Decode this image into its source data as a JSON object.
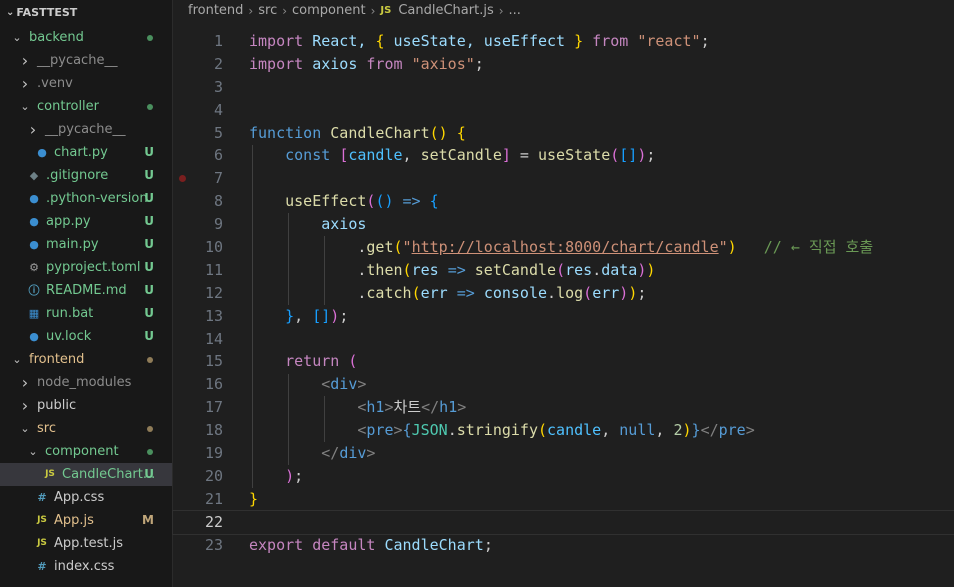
{
  "explorer": {
    "title": "FASTTEST",
    "colors": {
      "folder": "#cccccc",
      "modified": "#e2c08d",
      "untracked": "#73c991",
      "dot_green": "#73c991",
      "dot_tan": "#b59b6e"
    },
    "items": [
      {
        "label": "backend",
        "depth": 0,
        "chev": "down",
        "icon": "",
        "status": "dot",
        "dot_color": "#4a8f5e",
        "color": "#73c991"
      },
      {
        "label": "__pycache__",
        "depth": 1,
        "chev": "right",
        "icon": "",
        "status": "",
        "color": "#8c8c8c"
      },
      {
        "label": ".venv",
        "depth": 1,
        "chev": "right",
        "icon": "",
        "status": "",
        "color": "#8c8c8c"
      },
      {
        "label": "controller",
        "depth": 1,
        "chev": "down",
        "icon": "",
        "status": "dot",
        "dot_color": "#4a8f5e",
        "color": "#73c991"
      },
      {
        "label": "__pycache__",
        "depth": 2,
        "chev": "right",
        "icon": "",
        "status": "",
        "color": "#8c8c8c"
      },
      {
        "label": "chart.py",
        "depth": 2,
        "chev": "",
        "icon": "python",
        "status": "U",
        "color": "#73c991"
      },
      {
        "label": ".gitignore",
        "depth": 1,
        "chev": "",
        "icon": "git",
        "status": "U",
        "color": "#73c991"
      },
      {
        "label": ".python-version",
        "depth": 1,
        "chev": "",
        "icon": "python",
        "status": "U",
        "color": "#73c991"
      },
      {
        "label": "app.py",
        "depth": 1,
        "chev": "",
        "icon": "python",
        "status": "U",
        "color": "#73c991"
      },
      {
        "label": "main.py",
        "depth": 1,
        "chev": "",
        "icon": "python",
        "status": "U",
        "color": "#73c991"
      },
      {
        "label": "pyproject.toml",
        "depth": 1,
        "chev": "",
        "icon": "gear",
        "status": "U",
        "color": "#73c991"
      },
      {
        "label": "README.md",
        "depth": 1,
        "chev": "",
        "icon": "info",
        "status": "U",
        "color": "#73c991"
      },
      {
        "label": "run.bat",
        "depth": 1,
        "chev": "",
        "icon": "windows",
        "status": "U",
        "color": "#73c991"
      },
      {
        "label": "uv.lock",
        "depth": 1,
        "chev": "",
        "icon": "python",
        "status": "U",
        "color": "#73c991"
      },
      {
        "label": "frontend",
        "depth": 0,
        "chev": "down",
        "icon": "",
        "status": "dot",
        "dot_color": "#8f7c58",
        "color": "#e2c08d"
      },
      {
        "label": "node_modules",
        "depth": 1,
        "chev": "right",
        "icon": "",
        "status": "",
        "color": "#8c8c8c"
      },
      {
        "label": "public",
        "depth": 1,
        "chev": "right",
        "icon": "",
        "status": "",
        "color": "#cccccc"
      },
      {
        "label": "src",
        "depth": 1,
        "chev": "down",
        "icon": "",
        "status": "dot",
        "dot_color": "#8f7c58",
        "color": "#e2c08d"
      },
      {
        "label": "component",
        "depth": 2,
        "chev": "down",
        "icon": "",
        "status": "dot",
        "dot_color": "#4a8f5e",
        "color": "#73c991"
      },
      {
        "label": "CandleChart...",
        "depth": 3,
        "chev": "",
        "icon": "js",
        "status": "U",
        "color": "#73c991",
        "selected": true
      },
      {
        "label": "App.css",
        "depth": 2,
        "chev": "",
        "icon": "css",
        "status": "",
        "color": "#cccccc"
      },
      {
        "label": "App.js",
        "depth": 2,
        "chev": "",
        "icon": "js",
        "status": "M",
        "color": "#e2c08d"
      },
      {
        "label": "App.test.js",
        "depth": 2,
        "chev": "",
        "icon": "js",
        "status": "",
        "color": "#cccccc"
      },
      {
        "label": "index.css",
        "depth": 2,
        "chev": "",
        "icon": "css",
        "status": "",
        "color": "#cccccc"
      }
    ]
  },
  "breadcrumb": [
    "frontend",
    "src",
    "component",
    "CandleChart.js",
    "..."
  ],
  "editor": {
    "current_line": 22,
    "breakpoint_line": 7,
    "lines": [
      {
        "n": "1",
        "tokens": [
          [
            "import",
            "#c586c0"
          ],
          [
            " React, ",
            "#9cdcfe"
          ],
          [
            "{",
            "#ffd700"
          ],
          [
            " useState, useEffect ",
            "#9cdcfe"
          ],
          [
            "}",
            "#ffd700"
          ],
          [
            " from ",
            "#c586c0"
          ],
          [
            "\"react\"",
            "#ce9178"
          ],
          [
            ";",
            "#cccccc"
          ]
        ]
      },
      {
        "n": "2",
        "tokens": [
          [
            "import",
            "#c586c0"
          ],
          [
            " axios ",
            "#9cdcfe"
          ],
          [
            "from ",
            "#c586c0"
          ],
          [
            "\"axios\"",
            "#ce9178"
          ],
          [
            ";",
            "#cccccc"
          ]
        ]
      },
      {
        "n": "3",
        "tokens": []
      },
      {
        "n": "4",
        "tokens": []
      },
      {
        "n": "5",
        "tokens": [
          [
            "function ",
            "#569cd6"
          ],
          [
            "CandleChart",
            "#dcdcaa"
          ],
          [
            "() ",
            "#ffd700"
          ],
          [
            "{",
            "#ffd700"
          ]
        ]
      },
      {
        "n": "6",
        "tokens": [
          [
            "    const ",
            "#569cd6"
          ],
          [
            "[",
            "#da70d6"
          ],
          [
            "candle",
            "#4fc1ff"
          ],
          [
            ", ",
            "#cccccc"
          ],
          [
            "setCandle",
            "#dcdcaa"
          ],
          [
            "]",
            "#da70d6"
          ],
          [
            " = ",
            "#cccccc"
          ],
          [
            "useState",
            "#dcdcaa"
          ],
          [
            "(",
            "#da70d6"
          ],
          [
            "[]",
            "#179fff"
          ],
          [
            ")",
            "#da70d6"
          ],
          [
            ";",
            "#cccccc"
          ]
        ]
      },
      {
        "n": "7",
        "tokens": []
      },
      {
        "n": "8",
        "tokens": [
          [
            "    useEffect",
            "#dcdcaa"
          ],
          [
            "(",
            "#da70d6"
          ],
          [
            "() ",
            "#179fff"
          ],
          [
            "=> ",
            "#569cd6"
          ],
          [
            "{",
            "#179fff"
          ]
        ]
      },
      {
        "n": "9",
        "tokens": [
          [
            "        axios",
            "#9cdcfe"
          ]
        ]
      },
      {
        "n": "10",
        "tokens": [
          [
            "            .",
            "#cccccc"
          ],
          [
            "get",
            "#dcdcaa"
          ],
          [
            "(",
            "#ffd700"
          ],
          [
            "\"",
            "#ce9178"
          ],
          [
            "http://localhost:8000/chart/candle",
            "#ce9178",
            "url"
          ],
          [
            "\"",
            "#ce9178"
          ],
          [
            ")",
            "#ffd700"
          ],
          [
            "   ",
            "#cccccc"
          ],
          [
            "// ← 직접 호출",
            "#6a9955"
          ]
        ]
      },
      {
        "n": "11",
        "tokens": [
          [
            "            .",
            "#cccccc"
          ],
          [
            "then",
            "#dcdcaa"
          ],
          [
            "(",
            "#ffd700"
          ],
          [
            "res ",
            "#9cdcfe"
          ],
          [
            "=> ",
            "#569cd6"
          ],
          [
            "setCandle",
            "#dcdcaa"
          ],
          [
            "(",
            "#da70d6"
          ],
          [
            "res",
            "#9cdcfe"
          ],
          [
            ".",
            "#cccccc"
          ],
          [
            "data",
            "#9cdcfe"
          ],
          [
            ")",
            "#da70d6"
          ],
          [
            ")",
            "#ffd700"
          ]
        ]
      },
      {
        "n": "12",
        "tokens": [
          [
            "            .",
            "#cccccc"
          ],
          [
            "catch",
            "#dcdcaa"
          ],
          [
            "(",
            "#ffd700"
          ],
          [
            "err ",
            "#9cdcfe"
          ],
          [
            "=> ",
            "#569cd6"
          ],
          [
            "console",
            "#9cdcfe"
          ],
          [
            ".",
            "#cccccc"
          ],
          [
            "log",
            "#dcdcaa"
          ],
          [
            "(",
            "#da70d6"
          ],
          [
            "err",
            "#9cdcfe"
          ],
          [
            ")",
            "#da70d6"
          ],
          [
            ")",
            "#ffd700"
          ],
          [
            ";",
            "#cccccc"
          ]
        ]
      },
      {
        "n": "13",
        "tokens": [
          [
            "    ",
            "#cccccc"
          ],
          [
            "}",
            "#179fff"
          ],
          [
            ", ",
            "#cccccc"
          ],
          [
            "[]",
            "#179fff"
          ],
          [
            ")",
            "#da70d6"
          ],
          [
            ";",
            "#cccccc"
          ]
        ]
      },
      {
        "n": "14",
        "tokens": []
      },
      {
        "n": "15",
        "tokens": [
          [
            "    return ",
            "#c586c0"
          ],
          [
            "(",
            "#da70d6"
          ]
        ]
      },
      {
        "n": "16",
        "tokens": [
          [
            "        ",
            "#cccccc"
          ],
          [
            "<",
            "#808080"
          ],
          [
            "div",
            "#569cd6"
          ],
          [
            ">",
            "#808080"
          ]
        ]
      },
      {
        "n": "17",
        "tokens": [
          [
            "            ",
            "#cccccc"
          ],
          [
            "<",
            "#808080"
          ],
          [
            "h1",
            "#569cd6"
          ],
          [
            ">",
            "#808080"
          ],
          [
            "차트",
            "#cccccc"
          ],
          [
            "</",
            "#808080"
          ],
          [
            "h1",
            "#569cd6"
          ],
          [
            ">",
            "#808080"
          ]
        ]
      },
      {
        "n": "18",
        "tokens": [
          [
            "            ",
            "#cccccc"
          ],
          [
            "<",
            "#808080"
          ],
          [
            "pre",
            "#569cd6"
          ],
          [
            ">",
            "#808080"
          ],
          [
            "{",
            "#569cd6"
          ],
          [
            "JSON",
            "#4ec9b0"
          ],
          [
            ".",
            "#cccccc"
          ],
          [
            "stringify",
            "#dcdcaa"
          ],
          [
            "(",
            "#ffd700"
          ],
          [
            "candle",
            "#4fc1ff"
          ],
          [
            ", ",
            "#cccccc"
          ],
          [
            "null",
            "#569cd6"
          ],
          [
            ", ",
            "#cccccc"
          ],
          [
            "2",
            "#b5cea8"
          ],
          [
            ")",
            "#ffd700"
          ],
          [
            "}",
            "#569cd6"
          ],
          [
            "</",
            "#808080"
          ],
          [
            "pre",
            "#569cd6"
          ],
          [
            ">",
            "#808080"
          ]
        ]
      },
      {
        "n": "19",
        "tokens": [
          [
            "        ",
            "#cccccc"
          ],
          [
            "</",
            "#808080"
          ],
          [
            "div",
            "#569cd6"
          ],
          [
            ">",
            "#808080"
          ]
        ]
      },
      {
        "n": "20",
        "tokens": [
          [
            "    ",
            "#cccccc"
          ],
          [
            ")",
            "#da70d6"
          ],
          [
            ";",
            "#cccccc"
          ]
        ]
      },
      {
        "n": "21",
        "tokens": [
          [
            "}",
            "#ffd700"
          ]
        ]
      },
      {
        "n": "22",
        "tokens": []
      },
      {
        "n": "23",
        "tokens": [
          [
            "export ",
            "#c586c0"
          ],
          [
            "default ",
            "#c586c0"
          ],
          [
            "CandleChart",
            "#9cdcfe"
          ],
          [
            ";",
            "#cccccc"
          ]
        ]
      }
    ]
  }
}
